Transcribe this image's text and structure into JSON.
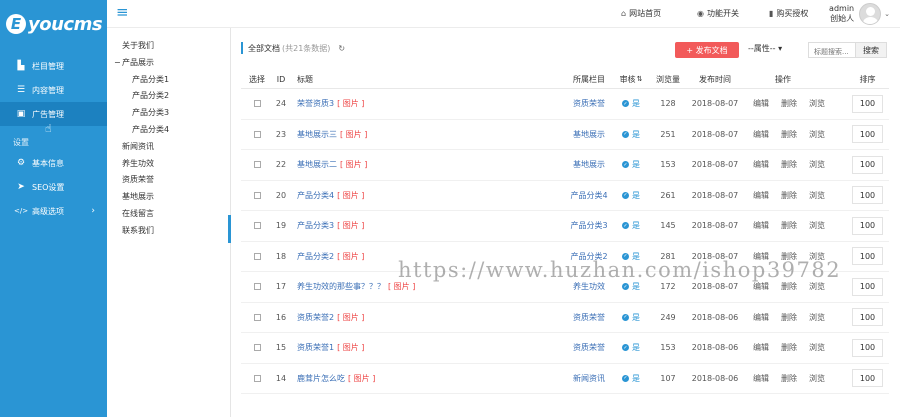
{
  "brand": {
    "logo_e": "E",
    "logo_text": "youcms"
  },
  "sidebar": {
    "items": [
      {
        "icon": "chart-bar-icon",
        "glyph": "▙",
        "label": "栏目管理"
      },
      {
        "icon": "list-icon",
        "glyph": "☰",
        "label": "内容管理"
      },
      {
        "icon": "image-icon",
        "glyph": "▣",
        "label": "广告管理"
      }
    ],
    "settings_heading": "设置",
    "settings_items": [
      {
        "icon": "gear-icon",
        "glyph": "⚙",
        "label": "基本信息"
      },
      {
        "icon": "paper-plane-icon",
        "glyph": "➤",
        "label": "SEO设置"
      },
      {
        "icon": "code-icon",
        "glyph": "</>",
        "label": "高级选项",
        "arrow": "›"
      }
    ]
  },
  "topbar": {
    "menu_glyph": "≡",
    "links": [
      {
        "icon": "home-icon",
        "glyph": "⌂",
        "label": "网站首页"
      },
      {
        "icon": "toggle-icon",
        "glyph": "◉",
        "label": "功能开关"
      },
      {
        "icon": "bookmark-icon",
        "glyph": "▮",
        "label": "购买授权"
      }
    ],
    "user_name": "admin",
    "user_role": "创始人",
    "caret": "⌄"
  },
  "tree": {
    "nodes": [
      {
        "label": "关于我们",
        "type": "root"
      },
      {
        "label": "产品展示",
        "type": "parent",
        "toggle": "−"
      },
      {
        "label": "产品分类1",
        "type": "child"
      },
      {
        "label": "产品分类2",
        "type": "child"
      },
      {
        "label": "产品分类3",
        "type": "child"
      },
      {
        "label": "产品分类4",
        "type": "child"
      },
      {
        "label": "新闻资讯",
        "type": "root"
      },
      {
        "label": "养生功效",
        "type": "root"
      },
      {
        "label": "资质荣誉",
        "type": "root"
      },
      {
        "label": "基地展示",
        "type": "root"
      },
      {
        "label": "在线留言",
        "type": "root"
      },
      {
        "label": "联系我们",
        "type": "root"
      }
    ]
  },
  "toolbar": {
    "list_title": "全部文档",
    "list_count": "(共21条数据)",
    "refresh_glyph": "↻",
    "add_label": "+ 发布文档",
    "attr_select": "--属性-- ▾",
    "search_placeholder": "标题搜索...",
    "search_button": "搜索"
  },
  "table": {
    "headers": {
      "select": "选择",
      "id": "ID",
      "title": "标题",
      "column": "所属栏目",
      "audit": "审核",
      "views": "浏览量",
      "date": "发布时间",
      "ops": "操作",
      "sort": "排序"
    },
    "audit_sort_glyph": "⇅",
    "rows": [
      {
        "id": "24",
        "title": "荣誉资质3",
        "tag": "[ 图片 ]",
        "column": "资质荣誉",
        "audit": "是",
        "views": "128",
        "date": "2018-08-07",
        "ops": [
          "编辑",
          "删除",
          "浏览"
        ],
        "sort": "100"
      },
      {
        "id": "23",
        "title": "基地展示三",
        "tag": "[ 图片 ]",
        "column": "基地展示",
        "audit": "是",
        "views": "251",
        "date": "2018-08-07",
        "ops": [
          "编辑",
          "删除",
          "浏览"
        ],
        "sort": "100"
      },
      {
        "id": "22",
        "title": "基地展示二",
        "tag": "[ 图片 ]",
        "column": "基地展示",
        "audit": "是",
        "views": "153",
        "date": "2018-08-07",
        "ops": [
          "编辑",
          "删除",
          "浏览"
        ],
        "sort": "100"
      },
      {
        "id": "20",
        "title": "产品分类4",
        "tag": "[ 图片 ]",
        "column": "产品分类4",
        "audit": "是",
        "views": "261",
        "date": "2018-08-07",
        "ops": [
          "编辑",
          "删除",
          "浏览"
        ],
        "sort": "100"
      },
      {
        "id": "19",
        "title": "产品分类3",
        "tag": "[ 图片 ]",
        "column": "产品分类3",
        "audit": "是",
        "views": "145",
        "date": "2018-08-07",
        "ops": [
          "编辑",
          "删除",
          "浏览"
        ],
        "sort": "100"
      },
      {
        "id": "18",
        "title": "产品分类2",
        "tag": "[ 图片 ]",
        "column": "产品分类2",
        "audit": "是",
        "views": "281",
        "date": "2018-08-07",
        "ops": [
          "编辑",
          "删除",
          "浏览"
        ],
        "sort": "100"
      },
      {
        "id": "17",
        "title": "养生功效的那些事？？？",
        "tag": "[ 图片 ]",
        "column": "养生功效",
        "audit": "是",
        "views": "172",
        "date": "2018-08-07",
        "ops": [
          "编辑",
          "删除",
          "浏览"
        ],
        "sort": "100"
      },
      {
        "id": "16",
        "title": "资质荣誉2",
        "tag": "[ 图片 ]",
        "column": "资质荣誉",
        "audit": "是",
        "views": "249",
        "date": "2018-08-06",
        "ops": [
          "编辑",
          "删除",
          "浏览"
        ],
        "sort": "100"
      },
      {
        "id": "15",
        "title": "资质荣誉1",
        "tag": "[ 图片 ]",
        "column": "资质荣誉",
        "audit": "是",
        "views": "153",
        "date": "2018-08-06",
        "ops": [
          "编辑",
          "删除",
          "浏览"
        ],
        "sort": "100"
      },
      {
        "id": "14",
        "title": "鹿茸片怎么吃",
        "tag": "[ 图片 ]",
        "column": "新闻资讯",
        "audit": "是",
        "views": "107",
        "date": "2018-08-06",
        "ops": [
          "编辑",
          "删除",
          "浏览"
        ],
        "sort": "100"
      }
    ]
  },
  "watermark": "https://www.huzhan.com/ishop39782",
  "colors": {
    "primary": "#2a95d4",
    "danger": "#f25a5a",
    "link": "#3b6fb6"
  }
}
